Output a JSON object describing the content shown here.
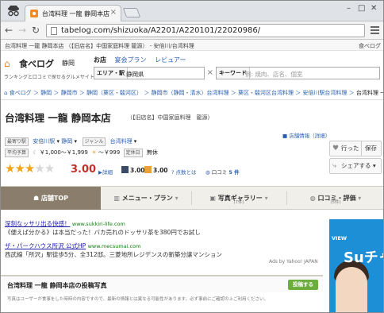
{
  "browser": {
    "tab_title": "台湾料理 一龍 静岡本店",
    "url": "tabelog.com/shizuoka/A2201/A220101/22020986/"
  },
  "topstrip": {
    "text": "台湾料理 一龍 静岡本店 （【旧店名】中国家庭料理 龍源） - 安倍川/台湾料理",
    "right": "食べログ"
  },
  "logo": {
    "name": "食べログ",
    "area": "静岡",
    "tagline": "ランキングと口コミで探せるグルメサイト"
  },
  "search_tabs": {
    "active": "お店",
    "items": [
      "宴会プラン",
      "レビュアー"
    ]
  },
  "search": {
    "area_label": "エリア・駅",
    "area_value": "静岡県",
    "keyword_label": "キーワード",
    "keyword_placeholder": "例: 焼肉、店名、個室"
  },
  "breadcrumb": {
    "items": [
      "食べログ",
      "静岡",
      "静岡市",
      "静岡（葵区・駿河区）",
      "静岡市（静岡・清水）台湾料理",
      "葵区・駿河区台湾料理",
      "安倍川駅台湾料理"
    ],
    "current": "台湾料理 一龍 静岡本店"
  },
  "restaurant": {
    "name": "台湾料理 一龍 静岡本店",
    "old_name": "（【旧店名】中国家庭料理　龍源）",
    "nearest_label": "最寄り駅",
    "nearest_value": "安倍川駅",
    "nearest_area": "静岡",
    "genre_label": "ジャンル",
    "genre_value": "台湾料理",
    "budget_label": "平均予算",
    "budget_lunch": "￥1,000～￥1,999",
    "budget_dinner": "～￥999",
    "holiday_label": "定休日",
    "holiday_value": "無休",
    "rating": 3.0,
    "rating_text": "3.00",
    "stars_filled": 3,
    "detail_label": "▶詳細",
    "night_score": "3.00",
    "lunch_score": "3.00",
    "points_label": "点数とは",
    "reviews_label": "口コミ",
    "reviews_count": "5 件",
    "store_info": "■ 店舗情報（詳細）"
  },
  "actions": {
    "visited": "行った",
    "saved": "保存",
    "share": "シェアする"
  },
  "detail_tabs": [
    {
      "label": "店舗TOP",
      "count": ""
    },
    {
      "label": "メニュー・プラン",
      "count": ""
    },
    {
      "label": "写真ギャラリー",
      "count": "(7件)"
    },
    {
      "label": "口コミ・評価",
      "count": "(5件)"
    }
  ],
  "ads": [
    {
      "title": "深刻なッサリ出る快感！",
      "url": "www.sukkiri-life.com",
      "desc": "《便えば分かる》は本当だった！バカ売れのドッサリ茶を380円でお試し"
    },
    {
      "title": "ザ・パークハウス所沢 公式HP",
      "url": "www.mecsumai.com",
      "desc": "西武線「所沢」駅徒歩5分、全312邸。三菱地所レジデンスの新築分譲マンション"
    }
  ],
  "ads_by": "Ads by Yahoo! JAPAN",
  "banner": {
    "brand": "VIEW",
    "text": "Suチャポ"
  },
  "photos": {
    "title": "台湾料理 一龍 静岡本店の投稿写真",
    "button": "投稿する",
    "note": "写真はユーザーが食事をした時時の内容ですので、最新の情報とは異なる可能性があります。必ず事前にご確認の上ご利用ください。"
  },
  "colors": {
    "accent": "#c0312b",
    "star": "#f2a418",
    "tab_active": "#8a7d6b",
    "link": "#2a5fb0",
    "banner": "#1c8fd6"
  }
}
